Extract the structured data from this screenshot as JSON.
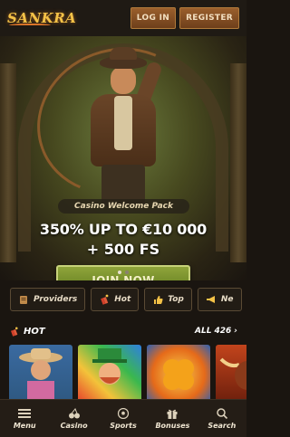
{
  "header": {
    "logo_text": "SANKRA",
    "login_label": "LOG IN",
    "register_label": "REGISTER"
  },
  "hero": {
    "welcome_pack": "Casino Welcome Pack",
    "promo_line1": "350% UP TO €10 000",
    "promo_line2": "+ 500 FS",
    "join_label": "JOIN NOW",
    "slides_total": 2,
    "slide_active": 1
  },
  "categories": [
    {
      "label": "Providers",
      "icon": "provider-icon"
    },
    {
      "label": "Hot",
      "icon": "dynamite-icon"
    },
    {
      "label": "Top",
      "icon": "thumbs-up-icon"
    },
    {
      "label": "Ne",
      "icon": "megaphone-icon"
    }
  ],
  "hot_section": {
    "title": "HOT",
    "all_label": "ALL",
    "count": "426",
    "games": [
      {
        "name": "cowboy-slot",
        "icon": "cowboy-thumbnail"
      },
      {
        "name": "leprechaun-slot",
        "icon": "leprechaun-thumbnail"
      },
      {
        "name": "clover-slot",
        "icon": "clover-thumbnail"
      },
      {
        "name": "bull-slot",
        "icon": "bull-thumbnail"
      }
    ]
  },
  "navbar": {
    "items": [
      {
        "label": "Menu",
        "icon": "hamburger-icon"
      },
      {
        "label": "Casino",
        "icon": "cherry-icon"
      },
      {
        "label": "Sports",
        "icon": "soccer-ball-icon"
      },
      {
        "label": "Bonuses",
        "icon": "gift-icon"
      },
      {
        "label": "Search",
        "icon": "search-icon"
      }
    ]
  },
  "colors": {
    "brand_gold": "#f4c247",
    "join_green": "#7a9030",
    "auth_brown": "#8a5426",
    "background": "#1a1510"
  }
}
